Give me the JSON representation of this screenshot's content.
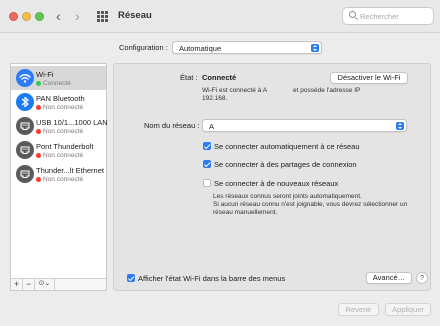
{
  "window": {
    "title": "Réseau"
  },
  "search": {
    "placeholder": "Rechercher"
  },
  "configuration": {
    "label": "Configuration :",
    "value": "Automatique"
  },
  "sidebar": {
    "services": [
      {
        "name": "Wi-Fi",
        "status": "Connecté",
        "status_color": "#34c759",
        "icon": "wifi-icon",
        "selected": true
      },
      {
        "name": "PAN Bluetooth",
        "status": "Non connecté",
        "status_color": "#ff3b30",
        "icon": "bluetooth-icon"
      },
      {
        "name": "USB 10/1...1000 LAN",
        "status": "Non connecté",
        "status_color": "#ff3b30",
        "icon": "ethernet-icon"
      },
      {
        "name": "Pont Thunderbolt",
        "status": "Non connecté",
        "status_color": "#ff3b30",
        "icon": "thunderbolt-bridge-icon"
      },
      {
        "name": "Thunder...lt Ethernet",
        "status": "Non connecté",
        "status_color": "#ff3b30",
        "icon": "thunderbolt-ethernet-icon"
      }
    ],
    "footer": {
      "add": "+",
      "remove": "−",
      "actions": "⊙⌄"
    }
  },
  "detail": {
    "status_label": "État :",
    "status_value": "Connecté",
    "disable_button": "Désactiver le Wi-Fi",
    "status_description_1": "Wi-Fi est connecté à A",
    "status_description_2": "et possède l'adresse IP",
    "ip_address": "192.168.",
    "network_name_label": "Nom du réseau :",
    "network_name_value": "A",
    "options": [
      {
        "label": "Se connecter automatiquement à ce réseau",
        "checked": true
      },
      {
        "label": "Se connecter à des partages de connexion",
        "checked": true
      },
      {
        "label": "Se connecter à de nouveaux réseaux",
        "checked": false
      }
    ],
    "new_networks_note": [
      "Les réseaux connus seront joints automatiquement.",
      "Si aucun réseau connu n'est joignable, vous devrez sélectionner un",
      "réseau manuellement."
    ],
    "show_in_menu_bar": {
      "label": "Afficher l'état Wi-Fi dans la barre des menus",
      "checked": true
    },
    "advanced_button": "Avancé…",
    "help_button": "?"
  },
  "footer_buttons": {
    "revert": "Revenir",
    "apply": "Appliquer"
  },
  "colors": {
    "accent": "#2d7cf6",
    "wifi_icon_bg": "#2d7cf6",
    "bluetooth_icon_bg": "#1a7cf5"
  }
}
